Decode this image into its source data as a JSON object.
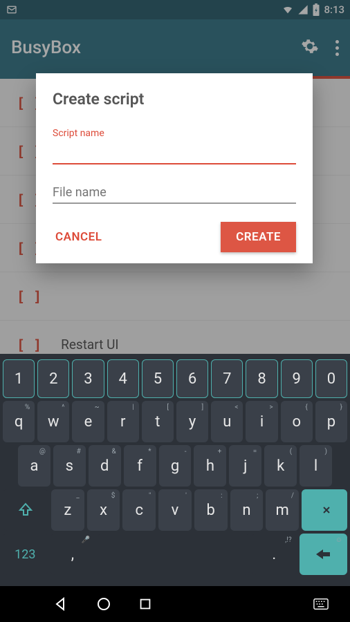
{
  "status": {
    "time": "8:13",
    "mail_icon": "mail-icon",
    "wifi_icon": "wifi-icon",
    "signal_icon": "signal-icon",
    "battery_icon": "battery-charging-icon"
  },
  "appbar": {
    "title": "BusyBox",
    "settings_icon": "gear-icon",
    "overflow_icon": "more-vert-icon"
  },
  "list": {
    "items": [
      {
        "label": ""
      },
      {
        "label": ""
      },
      {
        "label": ""
      },
      {
        "label": ""
      },
      {
        "label": ""
      },
      {
        "label": "Restart UI"
      }
    ]
  },
  "dialog": {
    "title": "Create script",
    "script_name_label": "Script name",
    "script_name_value": "",
    "file_name_label": "File name",
    "file_name_value": "",
    "cancel_label": "CANCEL",
    "create_label": "CREATE"
  },
  "keyboard": {
    "row_num": [
      "1",
      "2",
      "3",
      "4",
      "5",
      "6",
      "7",
      "8",
      "9",
      "0"
    ],
    "row_q": [
      {
        "m": "q",
        "h": "%"
      },
      {
        "m": "w",
        "h": "^"
      },
      {
        "m": "e",
        "h": "~"
      },
      {
        "m": "r",
        "h": "|"
      },
      {
        "m": "t",
        "h": "["
      },
      {
        "m": "y",
        "h": "]"
      },
      {
        "m": "u",
        "h": "<"
      },
      {
        "m": "i",
        "h": ">"
      },
      {
        "m": "o",
        "h": "{"
      },
      {
        "m": "p",
        "h": "}"
      }
    ],
    "row_a": [
      {
        "m": "a",
        "h": "@"
      },
      {
        "m": "s",
        "h": "#"
      },
      {
        "m": "d",
        "h": "&"
      },
      {
        "m": "f",
        "h": "*"
      },
      {
        "m": "g",
        "h": "-"
      },
      {
        "m": "h",
        "h": "+"
      },
      {
        "m": "j",
        "h": "="
      },
      {
        "m": "k",
        "h": "("
      },
      {
        "m": "l",
        "h": ")"
      }
    ],
    "row_z": [
      {
        "m": "z",
        "h": "_"
      },
      {
        "m": "x",
        "h": "$"
      },
      {
        "m": "c",
        "h": "\""
      },
      {
        "m": "v",
        "h": "'"
      },
      {
        "m": "b",
        "h": ":"
      },
      {
        "m": "n",
        "h": ";"
      },
      {
        "m": "m",
        "h": "/"
      }
    ],
    "fn_label": "123",
    "comma": ",",
    "period": ".",
    "period_hint": ",!?"
  },
  "colors": {
    "primary": "#3f7d8e",
    "accent": "#dd5644",
    "keyboard_teal": "#4fb0ad"
  }
}
